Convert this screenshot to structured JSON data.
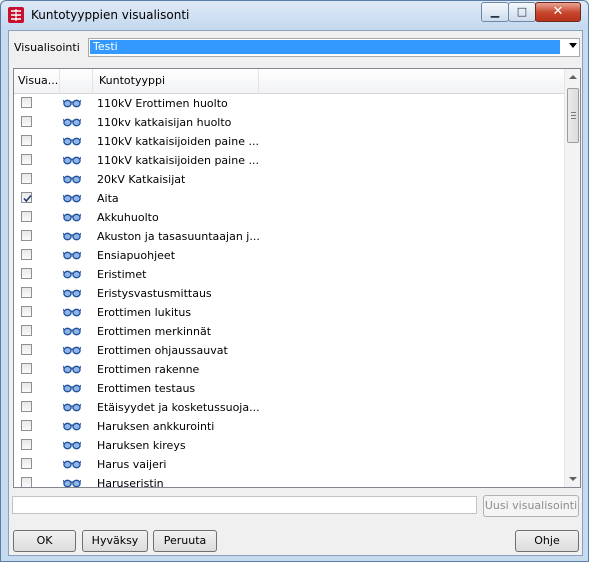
{
  "window": {
    "title": "Kuntotyyppien visualisonti"
  },
  "titlebar_buttons": {
    "minimize": "▁",
    "maximize": "□",
    "close": "✕"
  },
  "visualization": {
    "label": "Visualisointi",
    "selected": "Testi"
  },
  "table": {
    "headers": {
      "visible": "Visua...",
      "icon": "",
      "type": "Kuntotyyppi"
    },
    "rows": [
      {
        "checked": false,
        "label": "110kV Erottimen huolto"
      },
      {
        "checked": false,
        "label": "110kv katkaisijan huolto"
      },
      {
        "checked": false,
        "label": "110kV katkaisijoiden paine ..."
      },
      {
        "checked": false,
        "label": "110kV katkaisijoiden paine ..."
      },
      {
        "checked": false,
        "label": "20kV Katkaisijat"
      },
      {
        "checked": true,
        "label": "Aita"
      },
      {
        "checked": false,
        "label": "Akkuhuolto"
      },
      {
        "checked": false,
        "label": "Akuston ja tasasuuntaajan j..."
      },
      {
        "checked": false,
        "label": "Ensiapuohjeet"
      },
      {
        "checked": false,
        "label": "Eristimet"
      },
      {
        "checked": false,
        "label": "Eristysvastusmittaus"
      },
      {
        "checked": false,
        "label": "Erottimen lukitus"
      },
      {
        "checked": false,
        "label": "Erottimen merkinnät"
      },
      {
        "checked": false,
        "label": "Erottimen ohjaussauvat"
      },
      {
        "checked": false,
        "label": "Erottimen rakenne"
      },
      {
        "checked": false,
        "label": "Erottimen testaus"
      },
      {
        "checked": false,
        "label": "Etäisyydet ja kosketussuoja..."
      },
      {
        "checked": false,
        "label": "Haruksen ankkurointi"
      },
      {
        "checked": false,
        "label": "Haruksen kireys"
      },
      {
        "checked": false,
        "label": "Harus vaijeri"
      },
      {
        "checked": false,
        "label": "Haruseristin"
      }
    ],
    "row_icon": "glasses-icon"
  },
  "new_visualization": {
    "input_value": "",
    "button_label": "Uusi visualisointi"
  },
  "footer": {
    "ok": "OK",
    "accept": "Hyväksy",
    "cancel": "Peruuta",
    "help": "Ohje"
  },
  "colors": {
    "selection": "#3399ff",
    "titlebar": "#c4d8ef",
    "close_button": "#c7432a",
    "glasses": "#1f4f9a"
  }
}
